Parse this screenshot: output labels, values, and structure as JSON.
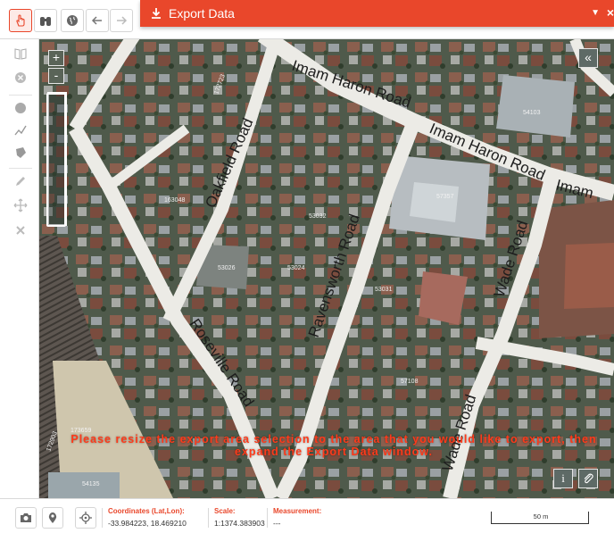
{
  "export_panel": {
    "title": "Export Data",
    "close_symbol": "×",
    "collapse_symbol": "▼"
  },
  "toolbar": {
    "icons": [
      "hand-pointer-icon",
      "binoculars-icon",
      "globe-icon",
      "arrow-left-icon",
      "arrow-right-icon"
    ]
  },
  "left_tools": {
    "icons": [
      "book-icon",
      "clear-circle-icon",
      "circle-icon",
      "polyline-icon",
      "polygon-icon",
      "pencil-icon",
      "move-icon",
      "delete-icon"
    ]
  },
  "map": {
    "zoom_in_label": "+",
    "zoom_out_label": "-",
    "collapse_label": "«",
    "info_label": "i",
    "streets": {
      "imam_haron_1": "Imam Haron Road",
      "imam_haron_2": "Imam Haron Road",
      "imam_haron_3": "Imam",
      "oakfield": "Oakfield Road",
      "ravensworth": "Ravensworth Road",
      "roseville": "Roseville Road",
      "wade_1": "Wade Road",
      "wade_2": "Wade Road"
    },
    "plots": [
      "54103",
      "57357",
      "53024",
      "53026",
      "53031",
      "53032",
      "57108",
      "54135",
      "173659",
      "172903",
      "172723",
      "163048"
    ],
    "instruction": "Please resize the export area selection to the area that you would like to export, then expand the Export Data window."
  },
  "status_bar": {
    "coordinates_label": "Coordinates (Lat,Lon):",
    "coordinates_value": "-33.984223, 18.469210",
    "scale_label": "Scale:",
    "scale_value": "1:1374.383903",
    "measurement_label": "Measurement:",
    "measurement_value": "---",
    "scale_bar_label": "50 m"
  },
  "colors": {
    "accent": "#e9472b",
    "road": "#ecebe6",
    "aerial_base": "#4d554b"
  }
}
